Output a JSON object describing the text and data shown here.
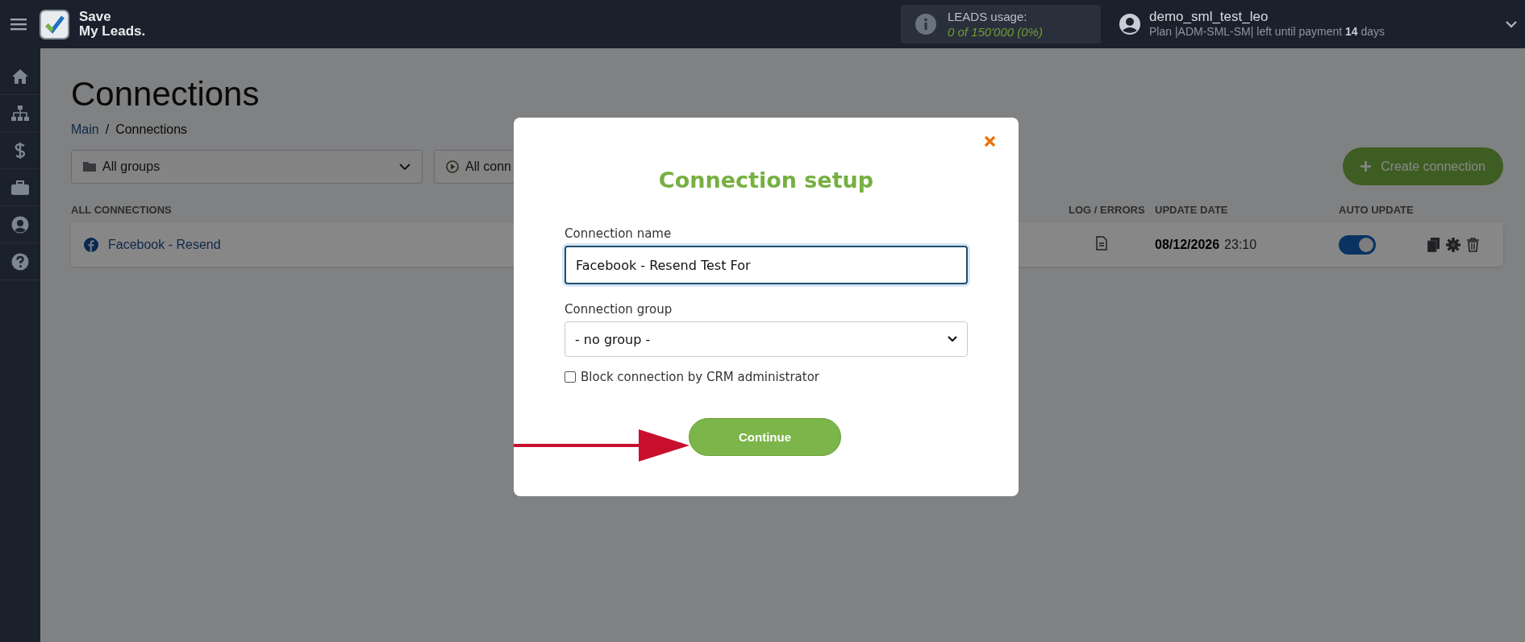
{
  "topbar": {
    "logo": [
      "Save",
      "My Leads."
    ],
    "usage_label": "LEADS usage:",
    "usage_value": "0 of 150'000 (0%)",
    "user_name": "demo_sml_test_leo",
    "plan": "Plan |ADM-SML-SM| left until payment **14** days"
  },
  "page": {
    "title": "Connections",
    "breadcrumb": [
      {
        "label": "Main",
        "kind": "link"
      },
      {
        "label": "/",
        "kind": "separator"
      },
      {
        "label": "Connections",
        "kind": "current"
      }
    ],
    "filters": [
      {
        "text": "All groups",
        "kind": "folder"
      },
      {
        "text": "All conn",
        "kind": "play"
      }
    ],
    "create_button": "Create connection",
    "columns": [
      "ALL CONNECTIONS",
      "LOG / ERRORS",
      "UPDATE DATE",
      "AUTO UPDATE"
    ],
    "rows": [
      {
        "name": "Facebook - Resend",
        "date": "08/12/2026",
        "time": "23:10",
        "auto_update": true
      }
    ]
  },
  "modal": {
    "title": "Connection setup",
    "name_label": "Connection name",
    "name_value": "Facebook - Resend Test For",
    "group_label": "Connection group",
    "group_value": "- no group -",
    "checkbox": {
      "label": "Block connection by CRM administrator",
      "checked": false
    },
    "continue": "Continue"
  }
}
